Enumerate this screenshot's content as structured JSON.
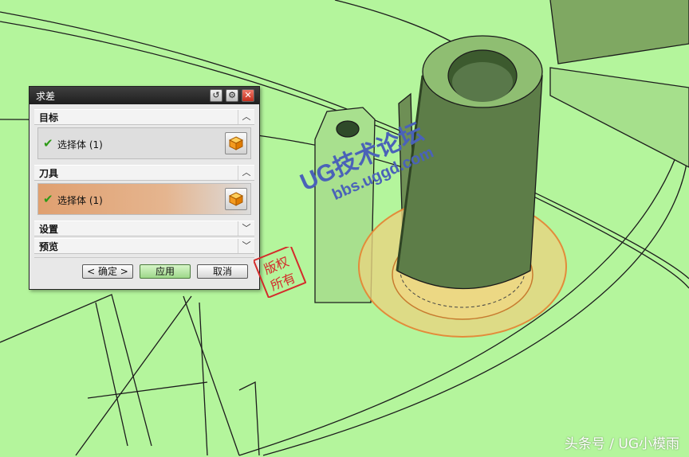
{
  "dialog": {
    "title": "求差",
    "sections": {
      "target": {
        "label": "目标",
        "row_label": "选择体 (1)"
      },
      "tool": {
        "label": "刀具",
        "row_label": "选择体 (1)"
      },
      "settings": {
        "label": "设置"
      },
      "preview": {
        "label": "预览"
      }
    },
    "buttons": {
      "ok": "< 确定 >",
      "apply": "应用",
      "cancel": "取消"
    }
  },
  "watermark": {
    "seal_chars": "版权所有",
    "forum_cn": "UG技术论坛",
    "forum_url": "bbs.uggd.com"
  },
  "credit": "头条号 / UG小模雨",
  "colors": {
    "background": "#b4f59c",
    "highlight": "#e0a070",
    "accent_check": "#2e9a17"
  }
}
